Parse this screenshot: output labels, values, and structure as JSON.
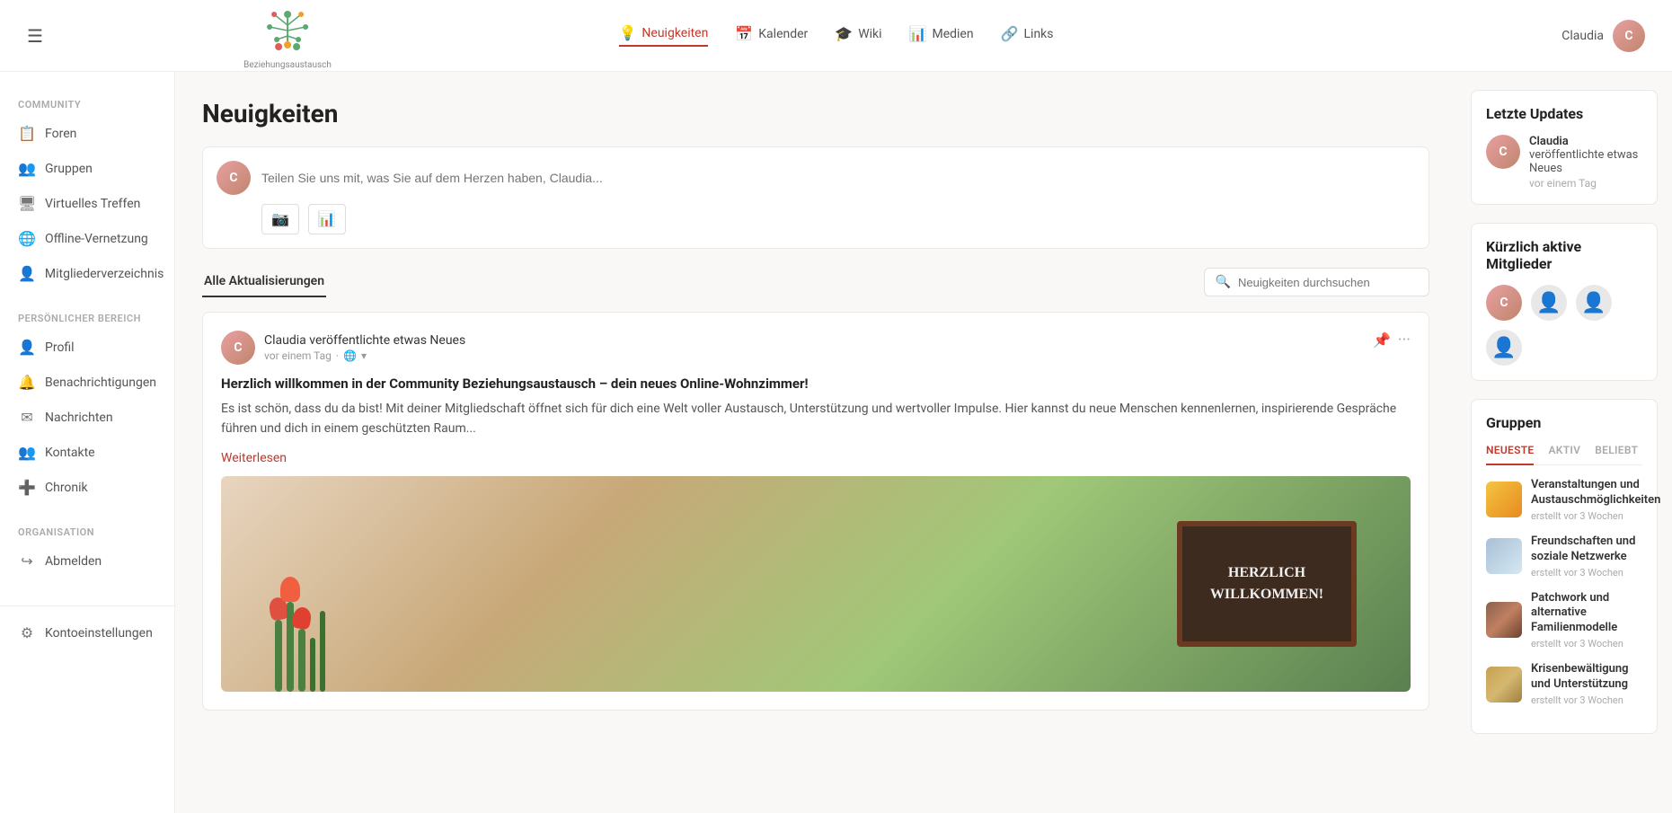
{
  "header": {
    "toggle_icon": "☰",
    "logo_icon": "🌿",
    "logo_text": "Beziehungsaustausch",
    "nav": [
      {
        "label": "Neuigkeiten",
        "icon": "💡",
        "active": true
      },
      {
        "label": "Kalender",
        "icon": "📅",
        "active": false
      },
      {
        "label": "Wiki",
        "icon": "🎓",
        "active": false
      },
      {
        "label": "Medien",
        "icon": "📊",
        "active": false
      },
      {
        "label": "Links",
        "icon": "🔗",
        "active": false
      }
    ],
    "user_name": "Claudia",
    "user_initials": "C"
  },
  "sidebar": {
    "community_label": "COMMUNITY",
    "community_items": [
      {
        "label": "Foren",
        "icon": "📋"
      },
      {
        "label": "Gruppen",
        "icon": "👥"
      },
      {
        "label": "Virtuelles Treffen",
        "icon": "🖥"
      },
      {
        "label": "Offline-Vernetzung",
        "icon": "🌐"
      },
      {
        "label": "Mitgliederverzeichnis",
        "icon": "👤"
      }
    ],
    "personal_label": "PERSÖNLICHER BEREICH",
    "personal_items": [
      {
        "label": "Profil",
        "icon": "👤"
      },
      {
        "label": "Benachrichtigungen",
        "icon": "🔔"
      },
      {
        "label": "Nachrichten",
        "icon": "✉"
      },
      {
        "label": "Kontakte",
        "icon": "👥"
      },
      {
        "label": "Chronik",
        "icon": "➕"
      }
    ],
    "org_label": "ORGANISATION",
    "org_items": [
      {
        "label": "Abmelden",
        "icon": "↪"
      }
    ],
    "bottom_items": [
      {
        "label": "Kontoeinstellungen",
        "icon": "⚙"
      }
    ]
  },
  "main": {
    "page_title": "Neuigkeiten",
    "post_placeholder": "Teilen Sie uns mit, was Sie auf dem Herzen haben, Claudia...",
    "photo_btn": "📷",
    "chart_btn": "📊",
    "filter_tabs": [
      {
        "label": "Alle Aktualisierungen",
        "active": true
      }
    ],
    "search_placeholder": "Neuigkeiten durchsuchen",
    "post": {
      "author": "Claudia",
      "author_initials": "C",
      "action": "veröffentlichte etwas Neues",
      "time": "vor einem Tag",
      "globe": "🌐",
      "dropdown": "▾",
      "title": "Herzlich willkommen in der Community Beziehungsaustausch – dein neues Online-Wohnzimmer!",
      "body": "Es ist schön, dass du da bist! Mit deiner Mitgliedschaft öffnet sich für dich eine Welt voller Austausch, Unterstützung und wertvoller Impulse. Hier kannst du neue Menschen kennenlernen, inspirierende Gespräche führen und dich in einem geschützten Raum...",
      "read_more": "Weiterlesen",
      "blackboard_line1": "HERZLICH",
      "blackboard_line2": "WILLKOMMEN!"
    }
  },
  "right_sidebar": {
    "updates_title": "Letzte Updates",
    "update": {
      "name": "Claudia",
      "initials": "C",
      "action": "veröffentlichte etwas Neues",
      "time": "vor einem Tag"
    },
    "members_title": "Kürzlich aktive Mitglieder",
    "groups_title": "Gruppen",
    "groups_tabs": [
      {
        "label": "NEUESTE",
        "active": true
      },
      {
        "label": "AKTIV",
        "active": false
      },
      {
        "label": "BELIEBT",
        "active": false
      }
    ],
    "groups": [
      {
        "name": "Veranstaltungen und Austauschmöglichkeiten",
        "meta": "erstellt vor 3 Wochen",
        "icon_class": "group-icon-1"
      },
      {
        "name": "Freundschaften und soziale Netzwerke",
        "meta": "erstellt vor 3 Wochen",
        "icon_class": "group-icon-2"
      },
      {
        "name": "Patchwork und alternative Familienmodelle",
        "meta": "erstellt vor 3 Wochen",
        "icon_class": "group-icon-3"
      },
      {
        "name": "Krisenbewältigung und Unterstützung",
        "meta": "erstellt vor 3 Wochen",
        "icon_class": "group-icon-4"
      }
    ]
  }
}
